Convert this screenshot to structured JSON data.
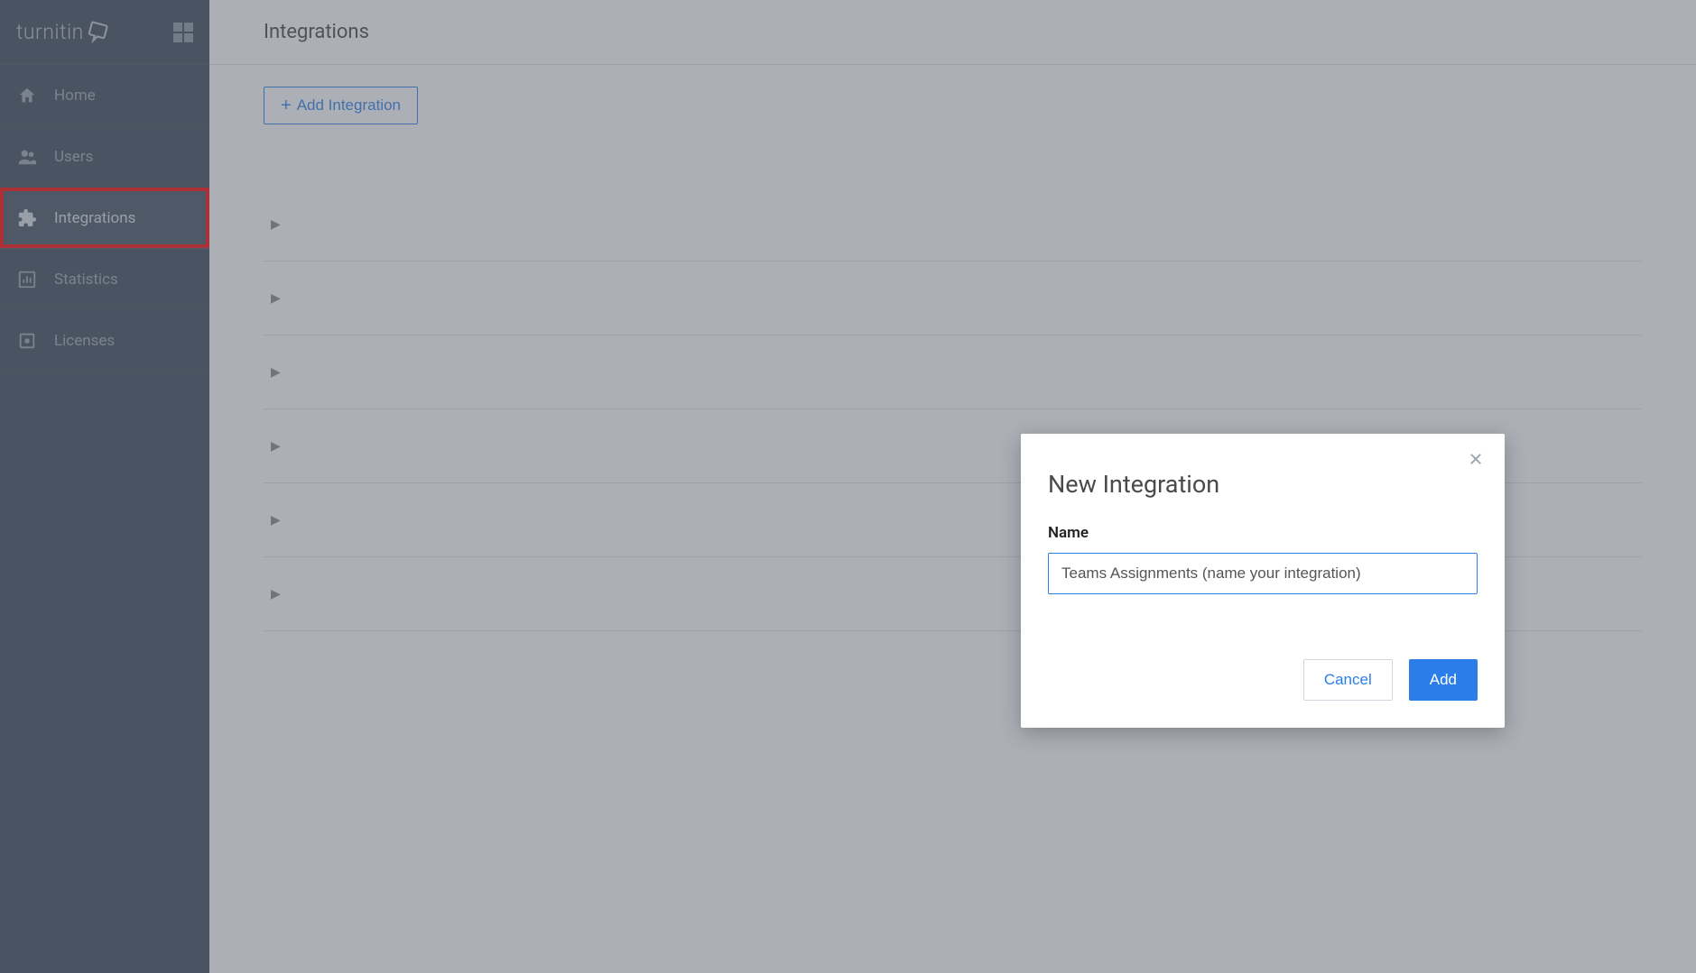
{
  "brand": {
    "name": "turnitin"
  },
  "sidebar": {
    "items": [
      {
        "label": "Home",
        "icon": "home-icon"
      },
      {
        "label": "Users",
        "icon": "users-icon"
      },
      {
        "label": "Integrations",
        "icon": "puzzle-icon"
      },
      {
        "label": "Statistics",
        "icon": "chart-icon"
      },
      {
        "label": "Licenses",
        "icon": "license-icon"
      }
    ],
    "active_index": 2
  },
  "page": {
    "title": "Integrations",
    "add_button_label": "Add Integration"
  },
  "modal": {
    "title": "New Integration",
    "name_label": "Name",
    "name_value": "Teams Assignments (name your integration)",
    "cancel_label": "Cancel",
    "add_label": "Add"
  },
  "integration_rows": 6
}
